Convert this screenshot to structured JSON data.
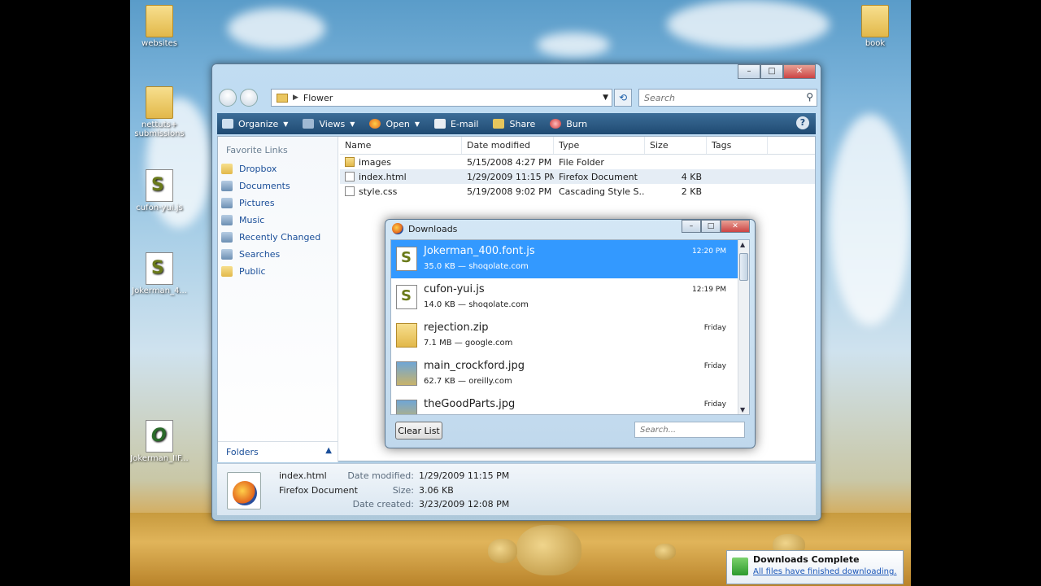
{
  "desktop": {
    "icons": [
      {
        "label": "websites"
      },
      {
        "label": "nettuts+ submissions"
      },
      {
        "label": "cufon-yui.js"
      },
      {
        "label": "Jokerman_4..."
      },
      {
        "label": "Jokerman_IIF..."
      },
      {
        "label": "book"
      }
    ]
  },
  "explorer": {
    "breadcrumb": "Flower",
    "search_placeholder": "Search",
    "toolbar": {
      "organize": "Organize",
      "views": "Views",
      "open": "Open",
      "email": "E-mail",
      "share": "Share",
      "burn": "Burn"
    },
    "nav": {
      "heading": "Favorite Links",
      "items": [
        {
          "label": "Dropbox"
        },
        {
          "label": "Documents"
        },
        {
          "label": "Pictures"
        },
        {
          "label": "Music"
        },
        {
          "label": "Recently Changed"
        },
        {
          "label": "Searches"
        },
        {
          "label": "Public"
        }
      ],
      "folders_label": "Folders"
    },
    "columns": [
      "Name",
      "Date modified",
      "Type",
      "Size",
      "Tags"
    ],
    "files": [
      {
        "name": "images",
        "date": "5/15/2008 4:27 PM",
        "type": "File Folder",
        "size": "",
        "kind": "folder"
      },
      {
        "name": "index.html",
        "date": "1/29/2009 11:15 PM",
        "type": "Firefox Document",
        "size": "4 KB",
        "kind": "page"
      },
      {
        "name": "style.css",
        "date": "5/19/2008 9:02 PM",
        "type": "Cascading Style S...",
        "size": "2 KB",
        "kind": "page"
      }
    ],
    "details": {
      "name": "index.html",
      "type": "Firefox Document",
      "date_modified_label": "Date modified:",
      "date_modified": "1/29/2009 11:15 PM",
      "size_label": "Size:",
      "size": "3.06 KB",
      "date_created_label": "Date created:",
      "date_created": "3/23/2009 12:08 PM"
    }
  },
  "downloads": {
    "title": "Downloads",
    "items": [
      {
        "name": "Jokerman_400.font.js",
        "meta": "35.0 KB — shoqolate.com",
        "time": "12:20 PM"
      },
      {
        "name": "cufon-yui.js",
        "meta": "14.0 KB — shoqolate.com",
        "time": "12:19 PM"
      },
      {
        "name": "rejection.zip",
        "meta": "7.1 MB — google.com",
        "time": "Friday"
      },
      {
        "name": "main_crockford.jpg",
        "meta": "62.7 KB — oreilly.com",
        "time": "Friday"
      },
      {
        "name": "theGoodParts.jpg",
        "meta": "",
        "time": "Friday"
      }
    ],
    "clear_label": "Clear List",
    "search_placeholder": "Search..."
  },
  "notification": {
    "title": "Downloads Complete",
    "link": "All files have finished downloading."
  }
}
